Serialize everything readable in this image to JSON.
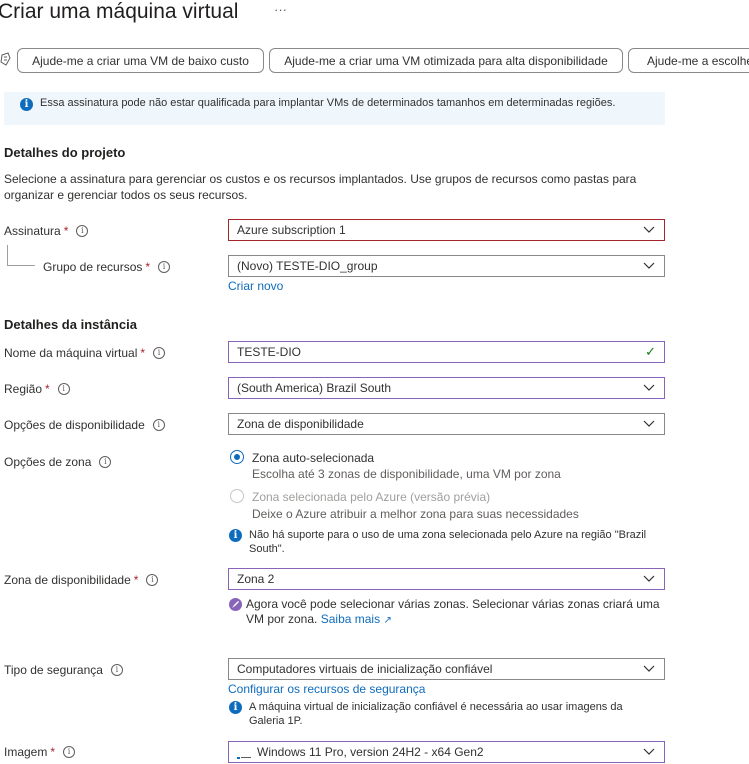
{
  "header": {
    "title": "Criar uma máquina virtual",
    "more": "···",
    "copilot_icon": "copilot-icon"
  },
  "suggestions": [
    "Ajude-me a criar uma VM de baixo custo",
    "Ajude-me a criar uma VM otimizada para alta disponibilidade",
    "Ajude-me a escolher"
  ],
  "info_banner": {
    "icon": "info-icon",
    "text": "Essa assinatura pode não estar qualificada para implantar VMs de determinados tamanhos em determinadas regiões."
  },
  "project": {
    "heading": "Detalhes do projeto",
    "description": "Selecione a assinatura para gerenciar os custos e os recursos implantados. Use grupos de recursos como pastas para organizar e gerenciar todos os seus recursos.",
    "subscription_label": "Assinatura",
    "subscription_value": "Azure subscription 1",
    "resource_group_label": "Grupo de recursos",
    "resource_group_value": "(Novo) TESTE-DIO_group",
    "create_new": "Criar novo"
  },
  "instance": {
    "heading": "Detalhes da instância",
    "vm_name_label": "Nome da máquina virtual",
    "vm_name_value": "TESTE-DIO",
    "region_label": "Região",
    "region_value": "(South America) Brazil South",
    "availability_label": "Opções de disponibilidade",
    "availability_value": "Zona de disponibilidade",
    "zone_options_label": "Opções de zona",
    "zone_auto_title": "Zona auto-selecionada",
    "zone_auto_desc": "Escolha até 3 zonas de disponibilidade, uma VM por zona",
    "zone_azure_title": "Zona selecionada pelo Azure (versão prévia)",
    "zone_azure_desc": "Deixe o Azure atribuir a melhor zona para suas necessidades",
    "zone_note": "Não há suporte para o uso de uma zona selecionada pelo Azure na região \"Brazil South\".",
    "availability_zone_label": "Zona de disponibilidade",
    "availability_zone_value": "Zona 2",
    "multi_zone_note": "Agora você pode selecionar várias zonas. Selecionar várias zonas criará uma VM por zona.",
    "learn_more": "Saiba mais",
    "security_label": "Tipo de segurança",
    "security_value": "Computadores virtuais de inicialização confiável",
    "configure_security": "Configurar os recursos de segurança",
    "security_note": "A máquina virtual de inicialização confiável é necessária ao usar imagens da Galeria 1P.",
    "image_label": "Imagem",
    "image_value": "Windows 11 Pro, version 24H2 - x64 Gen2"
  },
  "required_mark": "*",
  "tooltip_glyph": "i",
  "colors": {
    "accent": "#0f6cbd",
    "error_border": "#a4262c",
    "focus_border": "#8764b8",
    "info_bg": "#eff6fc",
    "success": "#107c10"
  }
}
